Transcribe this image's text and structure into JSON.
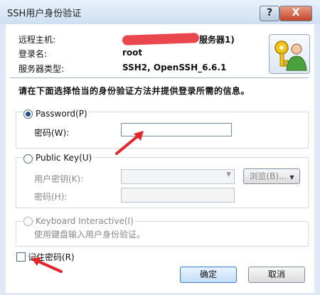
{
  "window": {
    "title": "SSH用户身份验证",
    "help_glyph": "?",
    "close_glyph": "X"
  },
  "info": {
    "host_label": "远程主机:",
    "host_value_suffix": "服务器1)",
    "login_label": "登录名:",
    "login_value": "root",
    "server_type_label": "服务器类型:",
    "server_type_value": "SSH2, OpenSSH_6.6.1"
  },
  "instruction": "请在下面选择恰当的身份验证方法并提供登录所需的信息。",
  "password_method": {
    "label": "Password(P)",
    "field_label": "密码(W):",
    "value": ""
  },
  "publickey_method": {
    "label": "Public Key(U)",
    "key_label": "用户密钥(K):",
    "key_value": "",
    "browse_label": "浏览(B)...",
    "passphrase_label": "密码(H):",
    "passphrase_value": ""
  },
  "keyboard_method": {
    "label": "Keyboard Interactive(I)",
    "description": "使用键盘输入用户身份验证。"
  },
  "remember": {
    "label": "记住密码(R)"
  },
  "buttons": {
    "ok": "确定",
    "cancel": "取消"
  },
  "colors": {
    "annotation_red": "#e3262b",
    "accent": "#3a79c7"
  }
}
